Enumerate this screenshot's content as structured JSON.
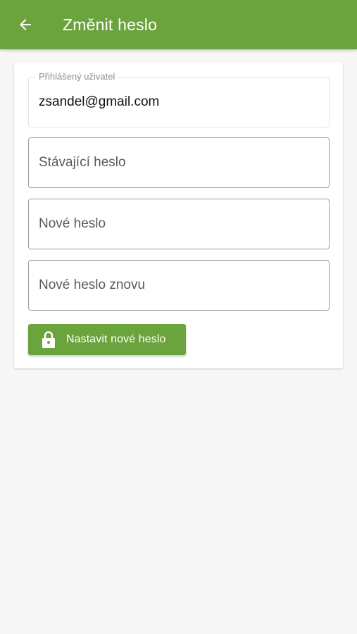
{
  "colors": {
    "primary": "#6ba33c",
    "background": "#f7f7f7",
    "card": "#ffffff"
  },
  "header": {
    "back_icon": "arrow-left-icon",
    "title": "Změnit heslo"
  },
  "form": {
    "logged_user": {
      "label": "Přihlášený uživatel",
      "value": "zsandel@gmail.com"
    },
    "current_password": {
      "placeholder": "Stávající heslo",
      "value": ""
    },
    "new_password": {
      "placeholder": "Nové heslo",
      "value": ""
    },
    "new_password_repeat": {
      "placeholder": "Nové heslo znovu",
      "value": ""
    },
    "submit": {
      "icon": "lock-icon",
      "label": "Nastavit nové heslo"
    }
  }
}
